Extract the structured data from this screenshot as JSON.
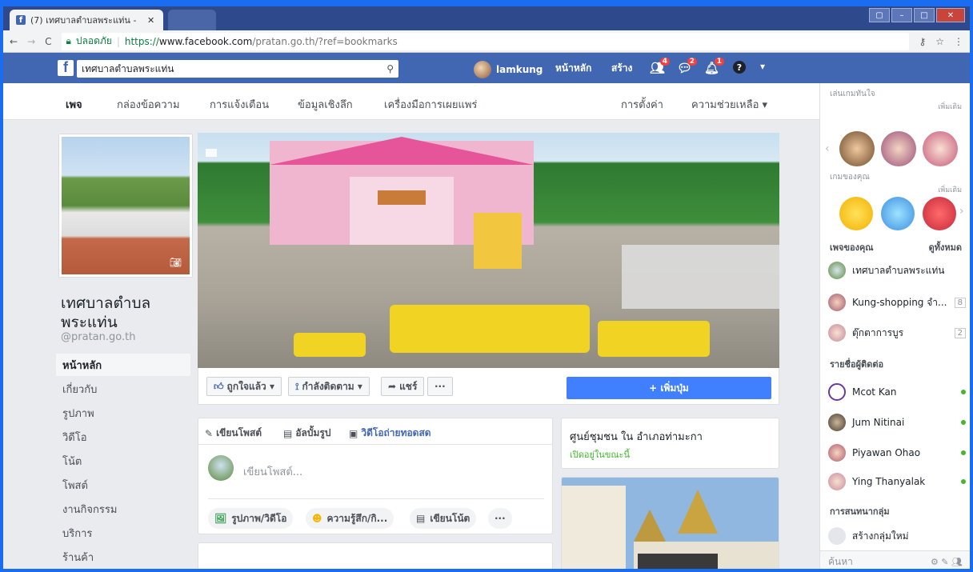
{
  "browser": {
    "tab_title": "(7) เทศบาลตำบลพระแท่น - ",
    "secure_label": "ปลอดภัย",
    "url_scheme": "https://",
    "url_host": "www.facebook.com",
    "url_path": "/pratan.go.th/?ref=bookmarks"
  },
  "fb": {
    "search_value": "เทศบาลตำบลพระแท่น",
    "user": "lamkung",
    "home": "หน้าหลัก",
    "create": "สร้าง",
    "badges": {
      "friends": "4",
      "messages": "2",
      "notifications": "1"
    }
  },
  "page_nav": [
    "เพจ",
    "กล่องข้อความ",
    "การแจ้งเตือน",
    "ข้อมูลเชิงลึก",
    "เครื่องมือการเผยแพร่",
    "การตั้งค่า",
    "ความช่วยเหลือ ▾"
  ],
  "page": {
    "name_line1": "เทศบาลตำบล",
    "name_line2": "พระแท่น",
    "handle": "@pratan.go.th"
  },
  "left_menu": [
    "หน้าหลัก",
    "เกี่ยวกับ",
    "รูปภาพ",
    "วิดีโอ",
    "โน้ต",
    "โพสต์",
    "งานกิจกรรม",
    "บริการ",
    "ร้านค้า"
  ],
  "cover_actions": {
    "like": "ถูกใจแล้ว ▾",
    "follow": "กำลังติดตาม ▾",
    "share": "แชร์",
    "more": "···",
    "add_button": "+ เพิ่มปุ่ม"
  },
  "composer": {
    "tab_post": "เขียนโพสต์",
    "tab_album": "อัลบั้มรูป",
    "tab_live": "วิดีโอถ่ายทอดสด",
    "placeholder": "เขียนโพสต์...",
    "chip_photo": "รูปภาพ/วิดีโอ",
    "chip_feeling": "ความรู้สึก/กิ...",
    "chip_note": "เขียนโน้ต",
    "chip_more": "···"
  },
  "community": {
    "title": "ศูนย์ชุมชน ใน อำเภอท่ามะกา",
    "status": "เปิดอยู่ในขณะนี้"
  },
  "sidebar": {
    "games_header": "เล่นเกมทันใจ",
    "games_more": "เพิ่มเติม",
    "your_games": "เกมของคุณ",
    "your_games_more": "เพิ่มเติม",
    "your_pages": "เพจของคุณ",
    "see_all": "ดูทั้งหมด",
    "pages": [
      {
        "name": "เทศบาลตำบลพระแท่น",
        "count": ""
      },
      {
        "name": "Kung-shopping จำ...",
        "count": "8"
      },
      {
        "name": "ตุ๊กตาการบูร",
        "count": "2"
      }
    ],
    "contacts_header": "รายชื่อผู้ติดต่อ",
    "contacts": [
      "Mcot Kan",
      "Jum Nitinai",
      "Piyawan Ohao",
      "Ying Thanyalak"
    ],
    "group_header": "การสนทนากลุ่ม",
    "create_group": "สร้างกลุ่มใหม่",
    "search_placeholder": "ค้นหา"
  },
  "colors": {
    "fb_blue": "#4267b2",
    "button_blue": "#4080ff",
    "online_green": "#42b72a",
    "badge_red": "#fa3e3e"
  }
}
